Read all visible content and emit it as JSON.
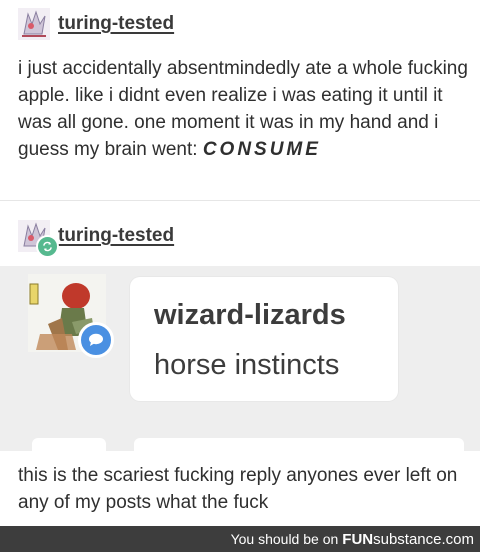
{
  "post1": {
    "username": "turing-tested",
    "text_main": "i just accidentally absentmindedly ate a whole fucking apple. like i didnt even realize i was eating it until it was all gone. one moment it was in my hand and i guess my brain went: ",
    "text_emph": "CONSUME"
  },
  "post2": {
    "username": "turing-tested",
    "reblog_icon": "reblog-icon",
    "embedded_reply": {
      "username": "wizard-lizards",
      "reply": "horse instincts",
      "badge_icon": "chat-bubble-icon",
      "badge_color": "#4a90e2"
    },
    "text": "this is the scariest fucking reply anyones ever left on any of my posts what the fuck"
  },
  "footer": {
    "prefix": "You should be on",
    "brand_bold": "FUN",
    "brand_rest": "substance.com"
  },
  "colors": {
    "reblog_green": "#56b98f",
    "footer_bg": "#3d3d3d",
    "embed_bg": "#eeeeee"
  }
}
